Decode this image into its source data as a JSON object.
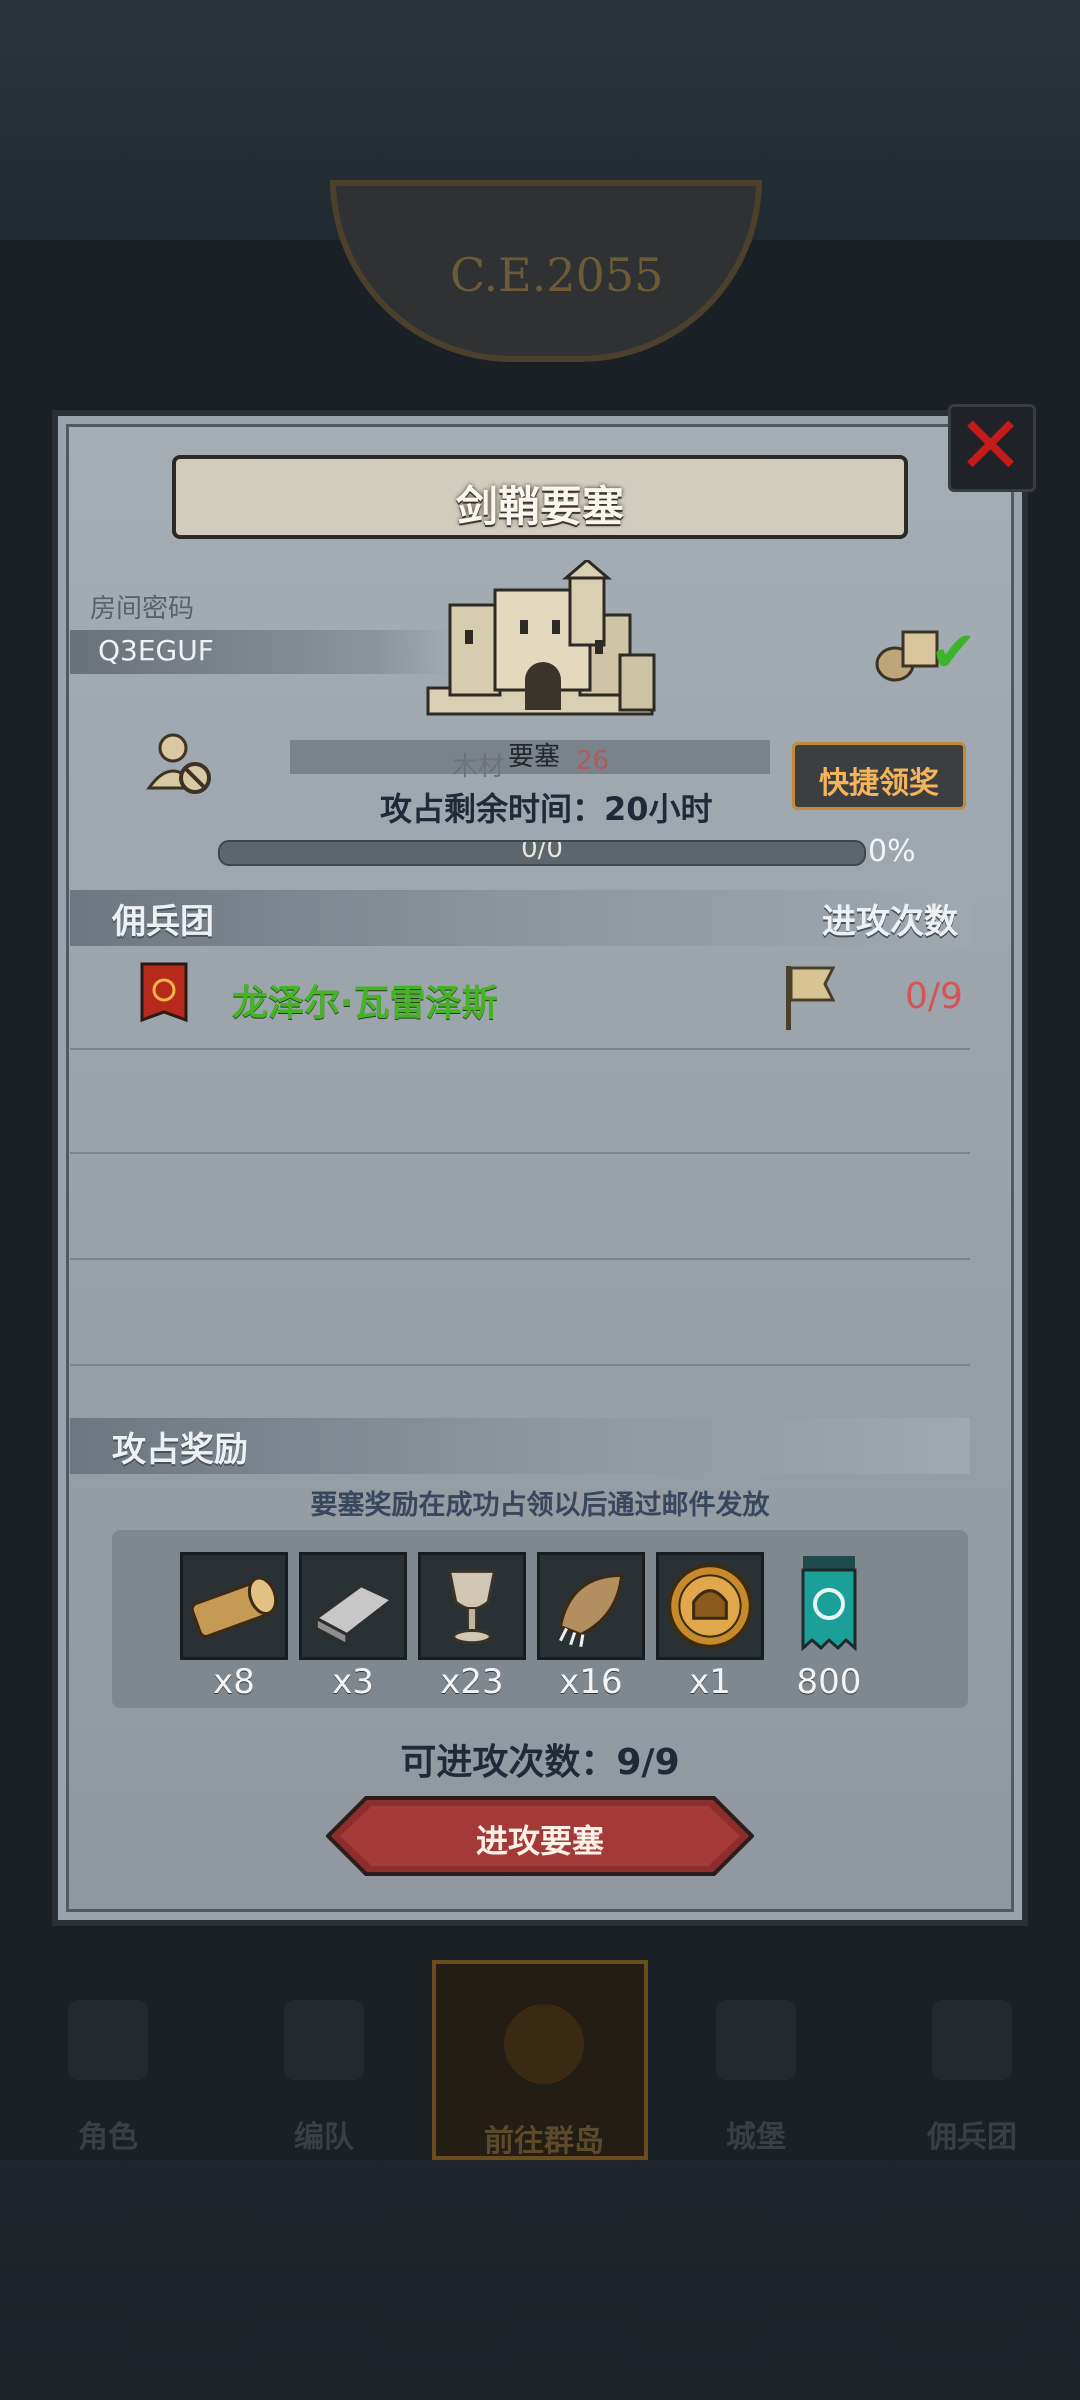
{
  "background": {
    "era_text": "C.E.2055"
  },
  "modal": {
    "title": "剑鞘要塞",
    "room_code_label": "房间密码",
    "room_code": "Q3EGUF",
    "fortress_label": "要塞",
    "faded_resource_label": "木材",
    "faded_resource_value": "26",
    "quick_claim_label": "快捷领奖",
    "time_left": "攻占剩余时间：20小时",
    "progress_text": "0/0",
    "progress_fraction": 0,
    "progress_percent": "0%",
    "mercenary_header": "佣兵团",
    "attack_count_header": "进攻次数",
    "mercenary_name": "龙泽尔·瓦雷泽斯",
    "mercenary_attacks": "0/9",
    "rewards_header": "攻占奖励",
    "reward_note": "要塞奖励在成功占领以后通过邮件发放",
    "rewards": [
      {
        "icon": "wood-log-icon",
        "qty": "x8"
      },
      {
        "icon": "iron-ingot-icon",
        "qty": "x3"
      },
      {
        "icon": "goblet-icon",
        "qty": "x23"
      },
      {
        "icon": "beast-paw-icon",
        "qty": "x16"
      },
      {
        "icon": "knight-medal-icon",
        "qty": "x1"
      },
      {
        "icon": "guild-banner-icon",
        "qty": "800"
      }
    ],
    "available_attacks": "可进攻次数：9/9",
    "attack_button": "进攻要塞"
  },
  "nav": [
    {
      "label": "角色",
      "icon": "knight-icon"
    },
    {
      "label": "编队",
      "icon": "formation-icon"
    },
    {
      "label": "前往群岛",
      "icon": "islands-icon",
      "active": true
    },
    {
      "label": "城堡",
      "icon": "castle-icon"
    },
    {
      "label": "佣兵团",
      "icon": "mercenary-icon"
    }
  ],
  "colors": {
    "accent_orange": "#f3b45b",
    "mercenary_green": "#44b424",
    "count_red": "#d65454",
    "close_red": "#c41a1a",
    "attack_button_red": "#8d2e2c"
  }
}
